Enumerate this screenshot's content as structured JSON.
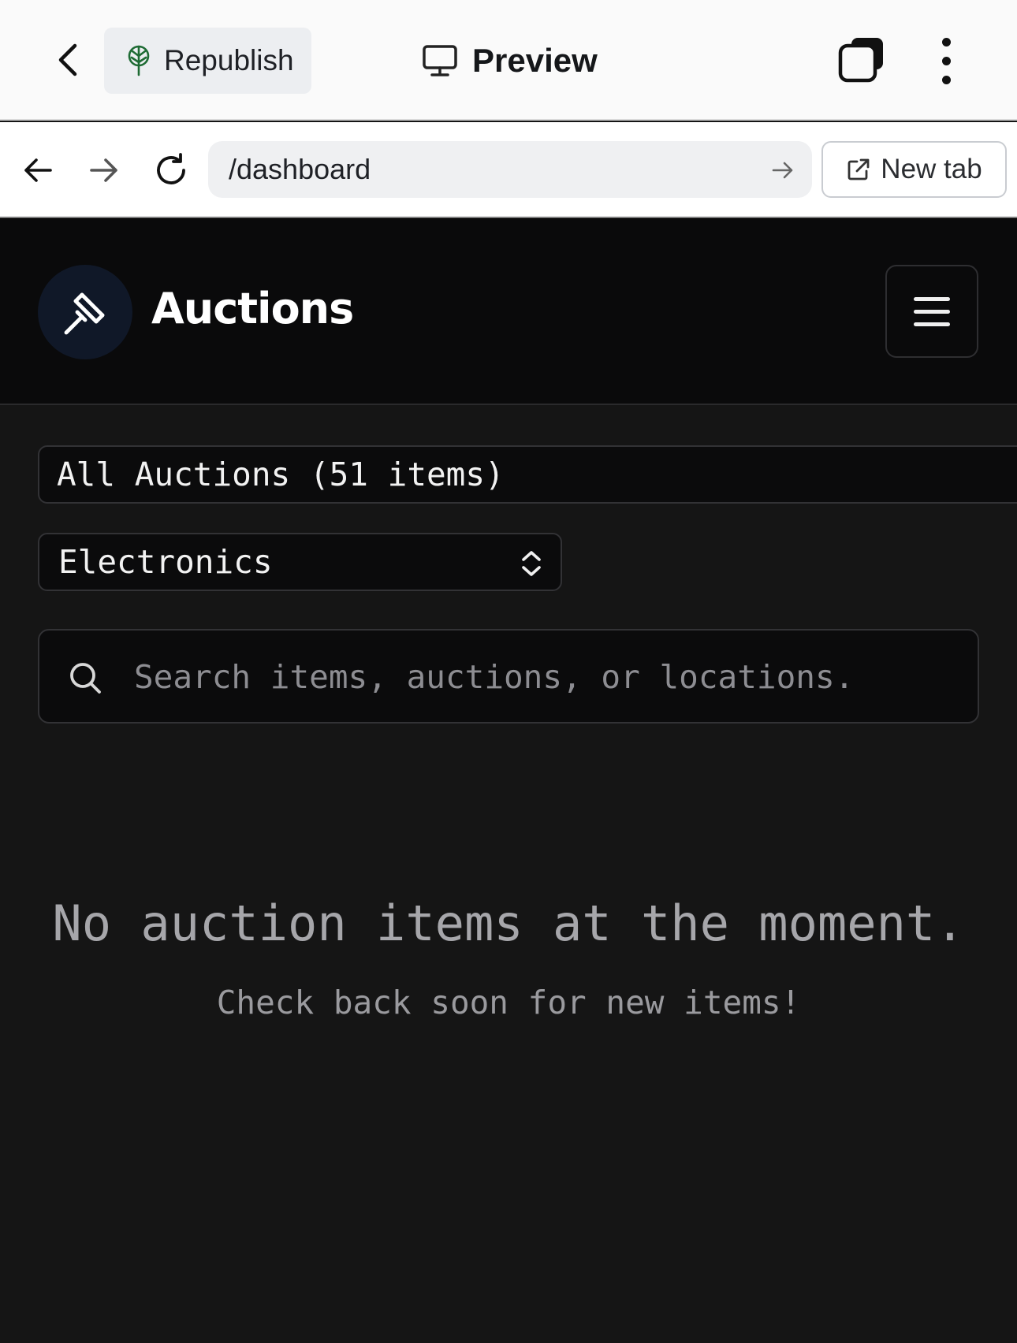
{
  "toolbar": {
    "republish_label": "Republish",
    "preview_label": "Preview",
    "icons": {
      "back": "chevron-left-icon",
      "republish": "tree-icon",
      "preview": "monitor-icon",
      "tabs": "tabs-icon",
      "more": "more-vertical-icon"
    }
  },
  "browser": {
    "url": "/dashboard",
    "new_tab_label": "New tab",
    "icons": {
      "back": "arrow-left-icon",
      "forward": "arrow-right-icon",
      "reload": "reload-icon",
      "go": "arrow-right-icon",
      "new_tab": "external-link-icon"
    }
  },
  "app": {
    "title": "Auctions",
    "logo_icon": "gavel-icon",
    "menu_icon": "hamburger-icon"
  },
  "filters": {
    "all_label": "All Auctions (51 items)",
    "category_selected": "Electronics",
    "search_placeholder": "Search items, auctions, or locations."
  },
  "empty_state": {
    "title": "No auction items at the moment.",
    "subtitle": "Check back soon for new items!"
  },
  "colors": {
    "app_background": "#151515",
    "header_background": "#0a0a0b",
    "logo_circle": "#101828",
    "republish_icon": "#1e6b34",
    "border": "#323235",
    "muted_text": "#a6a6aa"
  }
}
